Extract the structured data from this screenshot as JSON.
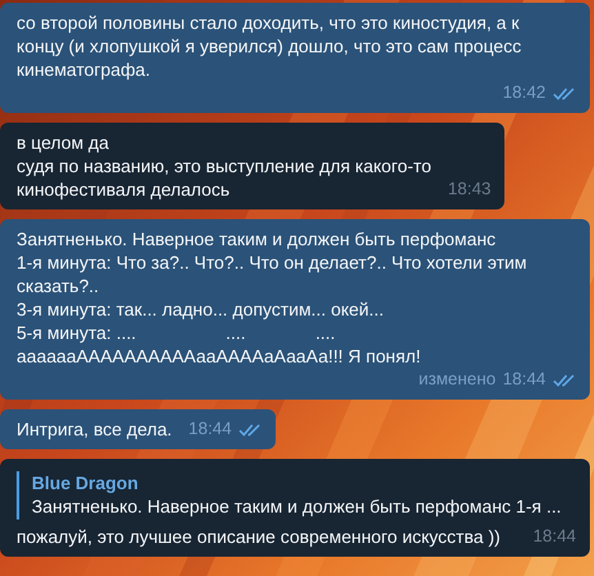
{
  "messages": [
    {
      "kind": "outgoing",
      "text": "со второй половины стало доходить, что это киностудия, а к\nконцу (и хлопушкой я уверился) дошло, что это сам процесс\nкинематографа.",
      "time": "18:42",
      "read": true
    },
    {
      "kind": "incoming",
      "text": "в целом да\nсудя по названию, это выступление для какого-то\nкинофестиваля делалось",
      "time": "18:43"
    },
    {
      "kind": "outgoing",
      "text": "Занятненько. Наверное таким и должен быть перфоманс\n1-я минута: Что за?.. Что?.. Что он делает?.. Что хотели этим\nсказать?..\n3-я минута: так... ладно... допустим... окей...\n5-я минута: ....                  ....              ....\nааааааААААААААААааААААаАааАа!!! Я понял!",
      "edited_label": "изменено",
      "time": "18:44",
      "read": true
    },
    {
      "kind": "outgoing",
      "text": "Интрига, все дела.",
      "time": "18:44",
      "read": true
    },
    {
      "kind": "incoming",
      "reply": {
        "author": "Blue Dragon",
        "text": "Занятненько. Наверное таким и должен быть перфоманс 1-я ..."
      },
      "text": "пожалуй, это лучшее описание современного искусства ))",
      "time": "18:44"
    }
  ]
}
